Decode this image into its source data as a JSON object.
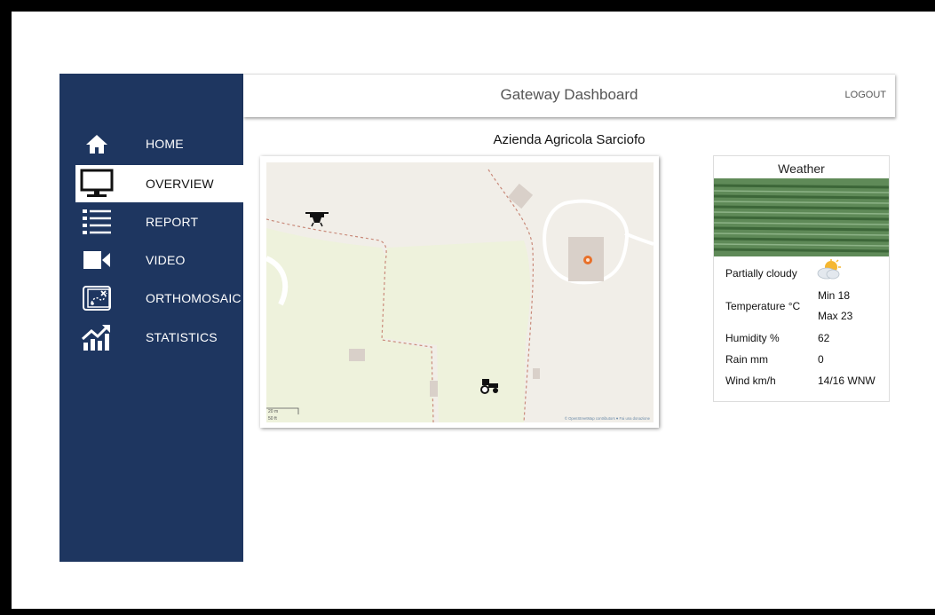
{
  "app": {
    "title": "Gateway Dashboard",
    "logout_label": "LOGOUT"
  },
  "sidebar": {
    "items": [
      {
        "label": "HOME",
        "icon": "home-icon"
      },
      {
        "label": "OVERVIEW",
        "icon": "monitor-icon",
        "active": true
      },
      {
        "label": "REPORT",
        "icon": "list-icon"
      },
      {
        "label": "VIDEO",
        "icon": "video-camera-icon"
      },
      {
        "label": "ORTHOMOSAIC",
        "icon": "map-plan-icon"
      },
      {
        "label": "STATISTICS",
        "icon": "growth-chart-icon"
      }
    ]
  },
  "main": {
    "farm_name": "Azienda Agricola Sarciofo",
    "map": {
      "attribution": "© OpenStreetMap contributors ♥ Fai una donazione",
      "scale_top": "20 m",
      "scale_bottom": "50 ft",
      "markers": [
        "drone-icon",
        "tractor-icon",
        "location-pin-icon"
      ]
    },
    "weather": {
      "title": "Weather",
      "condition": "Partially cloudy",
      "condition_icon": "partly-cloudy-icon",
      "temperature_label": "Temperature °C",
      "temp_min": "Min 18",
      "temp_max": "Max 23",
      "humidity_label": "Humidity %",
      "humidity_value": "62",
      "rain_label": "Rain mm",
      "rain_value": "0",
      "wind_label": "Wind km/h",
      "wind_value": "14/16 WNW"
    }
  },
  "colors": {
    "sidebar": "#1e3660",
    "map_land": "#f1eee8",
    "map_field": "#eef2dc",
    "marker": "#e8702a"
  }
}
